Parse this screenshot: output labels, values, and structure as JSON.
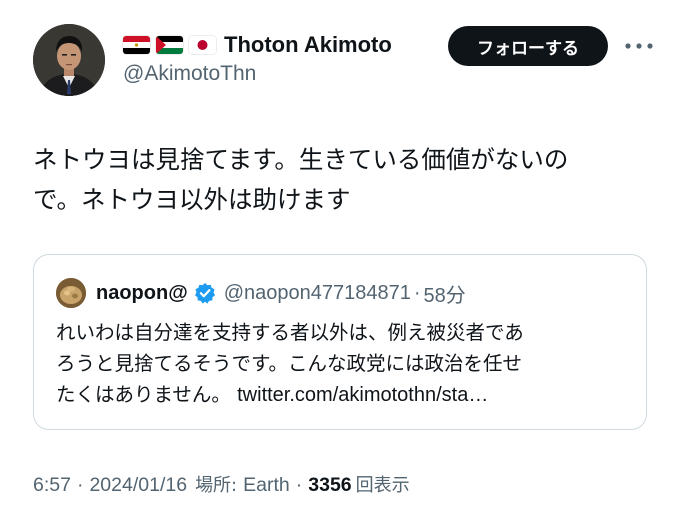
{
  "author": {
    "flags": [
      "egypt-flag-icon",
      "palestine-flag-icon",
      "japan-flag-icon"
    ],
    "display_name": "Thoton Akimoto",
    "handle": "@AkimotoThn"
  },
  "follow_label": "フォローする",
  "more_icon": "more-dots-icon",
  "tweet_text": {
    "line1": "ネトウヨは見捨てます。生きている価値がないの",
    "line2": "で。ネトウヨ以外は助けます"
  },
  "quote": {
    "display_name": "naopon@",
    "verified_icon": "verified-badge-icon",
    "handle": "@naopon477184871",
    "separator": "·",
    "time": "58分",
    "text_line1": "れいわは自分達を支持する者以外は、例え被災者であ",
    "text_line2": "ろうと見捨てるそうです。こんな政党には政治を任せ",
    "text_line3_prefix": "たくはありません。",
    "link": "twitter.com/akimotothn/sta…"
  },
  "meta": {
    "time": "6:57",
    "sep": "·",
    "date": "2024/01/16",
    "location_label": "場所:",
    "location": "Earth",
    "views_count": "3356",
    "views_label": "回表示"
  },
  "colors": {
    "text": "#0f1419",
    "secondary": "#536471",
    "border": "#cfd9de",
    "verified": "#1d9bf0",
    "button_bg": "#0f1419"
  }
}
